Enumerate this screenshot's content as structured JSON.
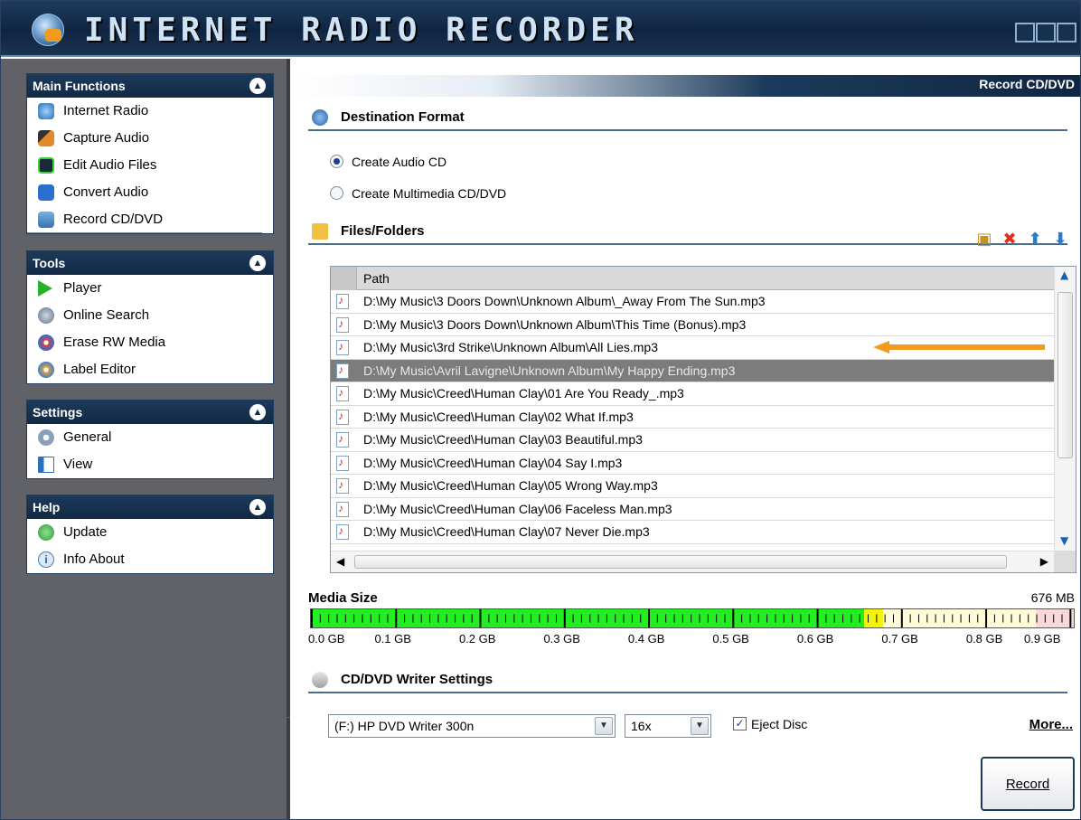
{
  "app": {
    "title": "INTERNET RADIO RECORDER"
  },
  "sidebar": {
    "main_functions": {
      "title": "Main Functions",
      "items": [
        {
          "label": "Internet Radio",
          "icon": "globe-music-icon"
        },
        {
          "label": "Capture Audio",
          "icon": "microphone-icon"
        },
        {
          "label": "Edit Audio Files",
          "icon": "waveform-icon"
        },
        {
          "label": "Convert Audio",
          "icon": "music-note-icon"
        },
        {
          "label": "Record CD/DVD",
          "icon": "cd-burn-icon",
          "selected": true
        }
      ]
    },
    "tools": {
      "title": "Tools",
      "items": [
        {
          "label": "Player",
          "icon": "play-icon"
        },
        {
          "label": "Online Search",
          "icon": "search-globe-icon"
        },
        {
          "label": "Erase RW Media",
          "icon": "erase-disc-icon"
        },
        {
          "label": "Label Editor",
          "icon": "label-icon"
        }
      ]
    },
    "settings": {
      "title": "Settings",
      "items": [
        {
          "label": "General",
          "icon": "gear-icon"
        },
        {
          "label": "View",
          "icon": "view-icon"
        }
      ]
    },
    "help": {
      "title": "Help",
      "items": [
        {
          "label": "Update",
          "icon": "update-icon"
        },
        {
          "label": "Info About",
          "icon": "info-icon"
        }
      ]
    }
  },
  "main": {
    "header": "Record CD/DVD",
    "destination_format": {
      "title": "Destination Format",
      "options": [
        {
          "label": "Create Audio CD",
          "selected": true
        },
        {
          "label": "Create Multimedia CD/DVD",
          "selected": false
        }
      ]
    },
    "files": {
      "title": "Files/Folders",
      "column": "Path",
      "rows": [
        "D:\\My Music\\3 Doors Down\\Unknown Album\\_Away From The Sun.mp3",
        "D:\\My Music\\3 Doors Down\\Unknown Album\\This Time (Bonus).mp3",
        "D:\\My Music\\3rd Strike\\Unknown Album\\All Lies.mp3",
        "D:\\My Music\\Avril Lavigne\\Unknown Album\\My Happy Ending.mp3",
        "D:\\My Music\\Creed\\Human Clay\\01 Are You Ready_.mp3",
        "D:\\My Music\\Creed\\Human Clay\\02 What If.mp3",
        "D:\\My Music\\Creed\\Human Clay\\03 Beautiful.mp3",
        "D:\\My Music\\Creed\\Human Clay\\04 Say I.mp3",
        "D:\\My Music\\Creed\\Human Clay\\05 Wrong Way.mp3",
        "D:\\My Music\\Creed\\Human Clay\\06 Faceless Man.mp3",
        "D:\\My Music\\Creed\\Human Clay\\07 Never Die.mp3"
      ],
      "highlighted_index": 3
    },
    "media": {
      "label": "Media Size",
      "value": "676 MB",
      "fill_fraction": 0.75,
      "ticks": [
        "0.0 GB",
        "0.1 GB",
        "0.2 GB",
        "0.3 GB",
        "0.4 GB",
        "0.5 GB",
        "0.6 GB",
        "0.7 GB",
        "0.8 GB",
        "0.9 GB"
      ]
    },
    "writer": {
      "title": "CD/DVD Writer Settings",
      "drive": "(F:) HP DVD Writer 300n",
      "speed": "16x",
      "eject_label": "Eject Disc",
      "eject_checked": true,
      "more_label": "More...",
      "record_label": "Record"
    }
  },
  "colors": {
    "accent": "#1c3a5c",
    "meter_green": "#22ee22",
    "meter_yellow": "#f2f20a",
    "arrow": "#f29b1c"
  }
}
